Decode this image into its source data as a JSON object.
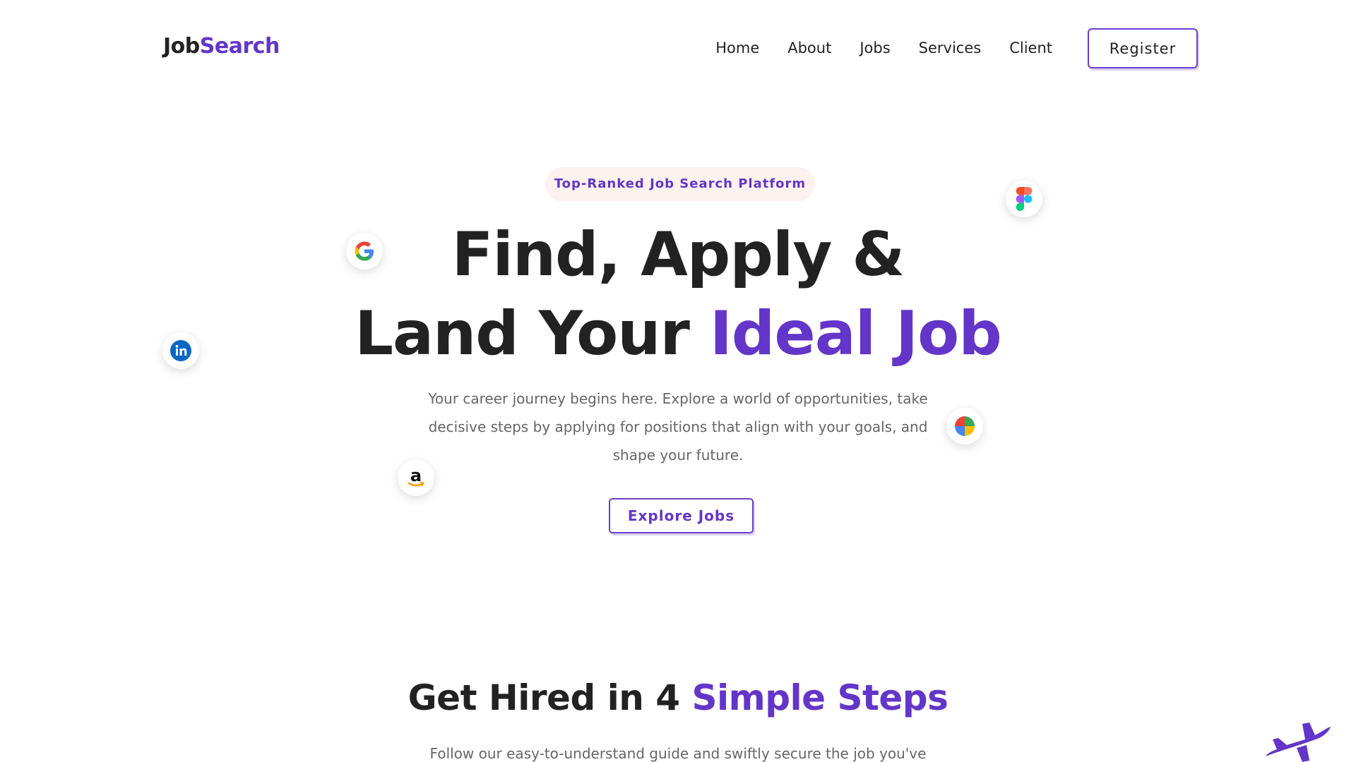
{
  "header": {
    "logo_part1": "Job",
    "logo_part2": "Search",
    "nav": [
      "Home",
      "About",
      "Jobs",
      "Services",
      "Client"
    ],
    "register_label": "Register"
  },
  "hero": {
    "badge": "Top-Ranked Job Search Platform",
    "title_line1": "Find, Apply &",
    "title_line2_plain": "Land Your ",
    "title_line2_accent": "Ideal Job",
    "description": "Your career journey begins here. Explore a world of opportunities, take decisive steps by applying for positions that align with your goals, and shape your future.",
    "cta_label": "Explore Jobs"
  },
  "floating_logos": [
    {
      "name": "figma-icon"
    },
    {
      "name": "google-icon"
    },
    {
      "name": "linkedin-icon"
    },
    {
      "name": "microsoft-icon"
    },
    {
      "name": "amazon-icon"
    }
  ],
  "steps": {
    "title_plain": "Get Hired in 4 ",
    "title_accent": "Simple Steps",
    "description": "Follow our easy-to-understand guide and swiftly secure the job you've"
  },
  "colors": {
    "accent": "#6435c9",
    "text": "#222222",
    "muted": "#666666",
    "badge_bg": "#fdf2f0"
  },
  "decor": {
    "plane_icon": "airplane-icon"
  }
}
